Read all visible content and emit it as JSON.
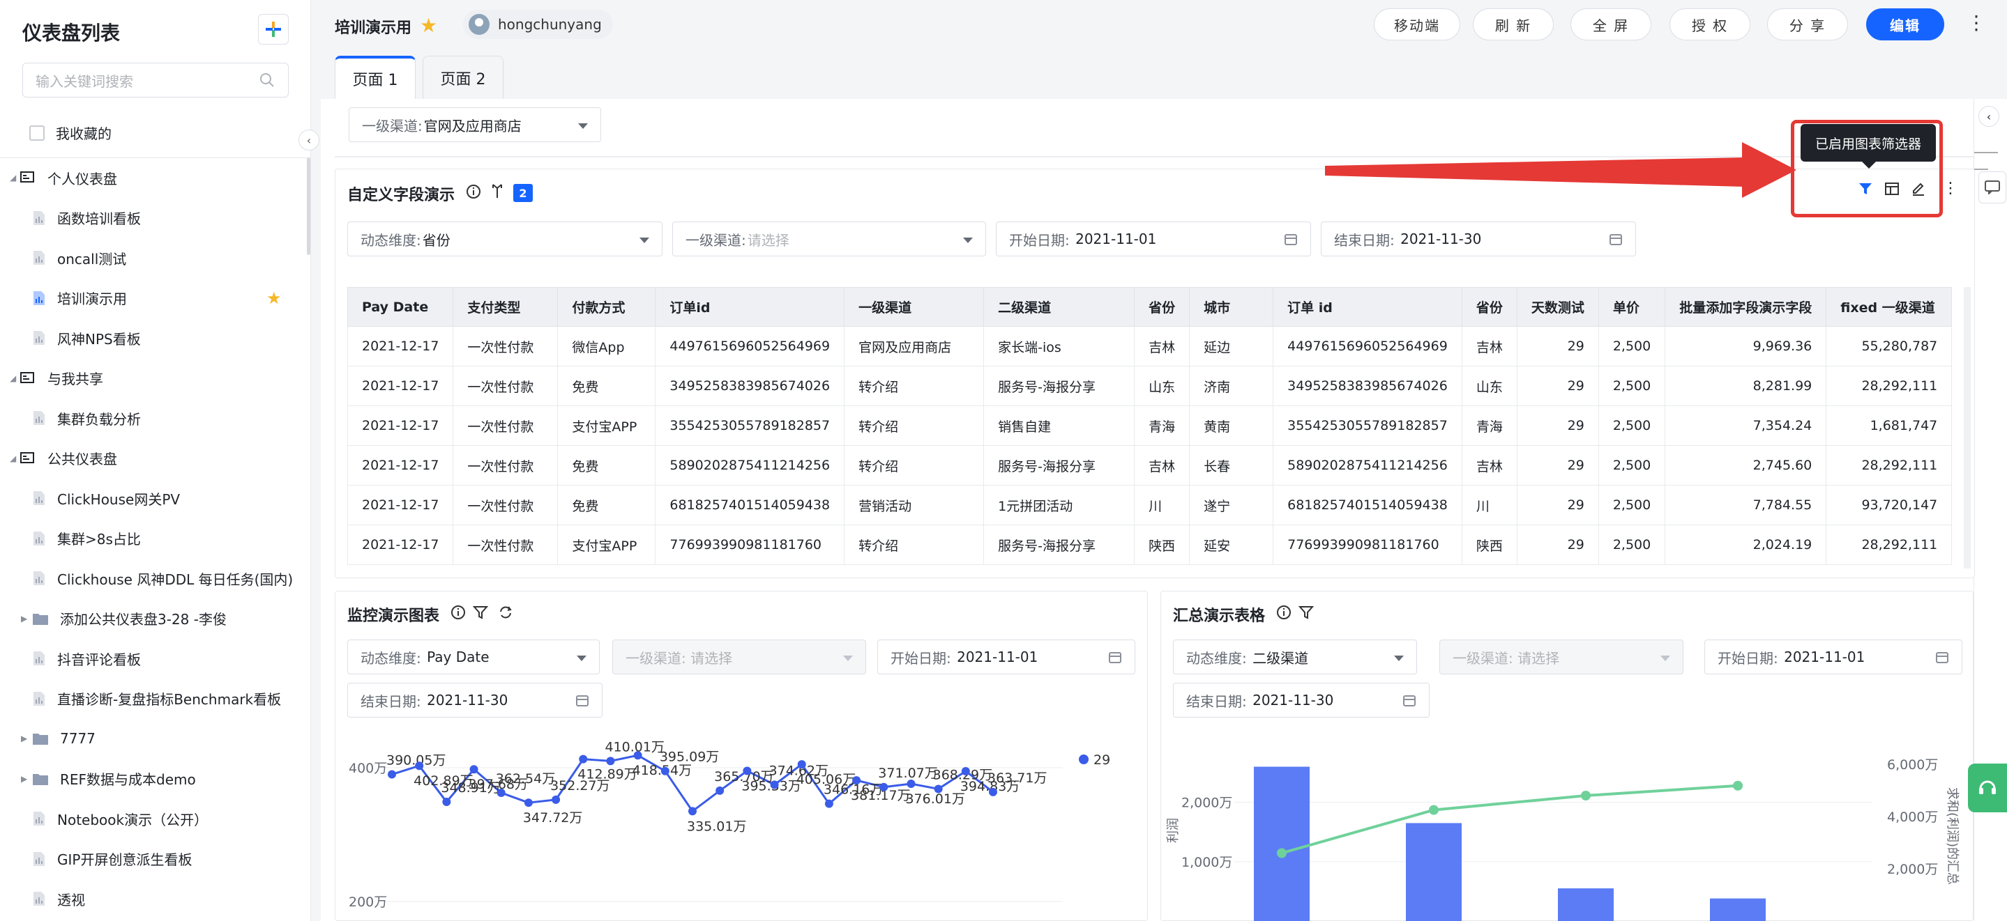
{
  "sidebar": {
    "title": "仪表盘列表",
    "search_placeholder": "输入关键词搜索",
    "favorites_label": "我收藏的",
    "groups": [
      {
        "label": "个人仪表盘",
        "items": [
          "函数培训看板",
          "oncall测试",
          "培训演示用",
          "风神NPS看板"
        ]
      },
      {
        "label": "与我共享",
        "items": [
          "集群负载分析"
        ]
      },
      {
        "label": "公共仪表盘",
        "items": [
          "ClickHouse网关PV",
          "集群>8s占比",
          "Clickhouse 风神DDL 每日任务(国内)",
          "添加公共仪表盘3-28 -李俊",
          "抖音评论看板",
          "直播诊断-复盘指标Benchmark看板",
          "7777",
          "REF数据与成本demo",
          "Notebook演示（公开）",
          "GIP开屏创意派生看板",
          "透视"
        ]
      }
    ]
  },
  "header": {
    "title": "培训演示用",
    "user": "hongchunyang",
    "buttons": {
      "mobile": "移动端",
      "refresh": "刷 新",
      "fullscreen": "全 屏",
      "auth": "授 权",
      "share": "分 享",
      "edit": "编辑"
    },
    "more": "⋮"
  },
  "tabs": [
    "页面 1",
    "页面 2"
  ],
  "global_filter": {
    "label": "一级渠道:",
    "value": "官网及应用商店"
  },
  "tooltip": "已启用图表筛选器",
  "card1": {
    "title": "自定义字段演示",
    "badge": "2",
    "filters": {
      "dim_label": "动态维度:",
      "dim_value": "省份",
      "ch_label": "一级渠道:",
      "ch_placeholder": "请选择",
      "start_label": "开始日期:",
      "start_value": "2021-11-01",
      "end_label": "结束日期:",
      "end_value": "2021-11-30"
    },
    "columns": [
      "Pay Date",
      "支付类型",
      "付款方式",
      "订单id",
      "一级渠道",
      "二级渠道",
      "省份",
      "城市",
      "订单 id",
      "省份",
      "天数测试",
      "单价",
      "批量添加字段演示字段",
      "fixed 一级渠道"
    ],
    "rows": [
      [
        "2021-12-17",
        "一次性付款",
        "微信App",
        "4497615696052564969",
        "官网及应用商店",
        "家长端-ios",
        "吉林",
        "延边",
        "4497615696052564969",
        "吉林",
        "29",
        "2,500",
        "9,969.36",
        "55,280,787"
      ],
      [
        "2021-12-17",
        "一次性付款",
        "免费",
        "3495258383985674026",
        "转介绍",
        "服务号-海报分享",
        "山东",
        "济南",
        "3495258383985674026",
        "山东",
        "29",
        "2,500",
        "8,281.99",
        "28,292,111"
      ],
      [
        "2021-12-17",
        "一次性付款",
        "支付宝APP",
        "3554253055789182857",
        "转介绍",
        "销售自建",
        "青海",
        "黄南",
        "3554253055789182857",
        "青海",
        "29",
        "2,500",
        "7,354.24",
        "1,681,747"
      ],
      [
        "2021-12-17",
        "一次性付款",
        "免费",
        "5890202875411214256",
        "转介绍",
        "服务号-海报分享",
        "吉林",
        "长春",
        "5890202875411214256",
        "吉林",
        "29",
        "2,500",
        "2,745.60",
        "28,292,111"
      ],
      [
        "2021-12-17",
        "一次性付款",
        "免费",
        "6818257401514059438",
        "营销活动",
        "1元拼团活动",
        "川",
        "遂宁",
        "6818257401514059438",
        "川",
        "29",
        "2,500",
        "7,784.55",
        "93,720,147"
      ],
      [
        "2021-12-17",
        "一次性付款",
        "支付宝APP",
        "776993990981181760",
        "转介绍",
        "服务号-海报分享",
        "陕西",
        "延安",
        "776993990981181760",
        "陕西",
        "29",
        "2,500",
        "2,024.19",
        "28,292,111"
      ]
    ]
  },
  "card2": {
    "title": "监控演示图表",
    "filters": {
      "dim_label": "动态维度:",
      "dim_value": "Pay Date",
      "ch_label": "一级渠道:",
      "ch_placeholder": "请选择",
      "start_label": "开始日期:",
      "start_value": "2021-11-01",
      "end_label": "结束日期:",
      "end_value": "2021-11-30"
    }
  },
  "card3": {
    "title": "汇总演示表格",
    "filters": {
      "dim_label": "动态维度:",
      "dim_value": "二级渠道",
      "ch_label": "一级渠道:",
      "ch_placeholder": "请选择",
      "start_label": "开始日期:",
      "start_value": "2021-11-01",
      "end_label": "结束日期:",
      "end_value": "2021-11-30"
    }
  },
  "chart_data": [
    {
      "type": "line",
      "yticks": [
        "400万",
        "200万"
      ],
      "ylim": [
        100,
        500
      ],
      "legend": "29",
      "color": "#3a5ce8",
      "values": [
        390.05,
        402.89,
        348.91,
        397.68,
        362.54,
        347.72,
        352.27,
        412.89,
        410.01,
        418.54,
        395.09,
        335.01,
        365.7,
        395.33,
        374.62,
        405.06,
        346.16,
        381.17,
        371.07,
        376.01,
        368.29,
        394.83,
        363.71
      ],
      "labels": [
        "390.05万",
        "402.89万",
        "348.91万",
        "397.68万",
        "362.54万",
        "347.72万",
        "352.27万",
        "412.89万",
        "410.01万",
        "418.54万",
        "395.09万",
        "335.01万",
        "365.70万",
        "395.33万",
        "374.62万",
        "405.06万",
        "346.16万",
        "381.17万",
        "371.07万",
        "376.01万",
        "368.29万",
        "394.83万",
        "363.71万"
      ]
    },
    {
      "type": "bar",
      "ylabel": "利润",
      "y2label": "求和(利润)的汇总",
      "yticks": [
        "2,000万",
        "1,000万"
      ],
      "y2ticks": [
        "6,000万",
        "4,000万",
        "2,000万"
      ],
      "ylim": [
        0,
        2700
      ],
      "y2lim": [
        0,
        8000
      ],
      "bar_color": "#5b7cf5",
      "line_color": "#6fd19a",
      "values": [
        2600,
        1650,
        550,
        380
      ],
      "cumulative": [
        2600,
        4250,
        4800,
        5180
      ]
    }
  ]
}
